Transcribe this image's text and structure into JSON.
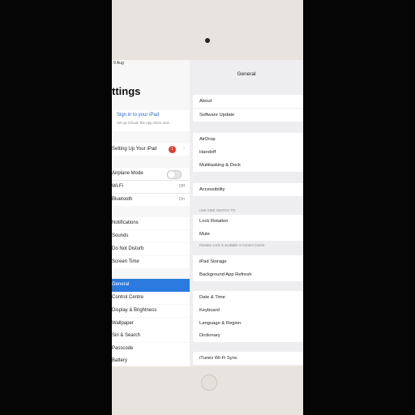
{
  "status": {
    "time": "9 Aug"
  },
  "sidebar": {
    "title": "ttings",
    "signin": {
      "title": "Sign in to your iPad",
      "subtitle": "Set up iCloud, the App Store and..."
    },
    "setup": {
      "label": "Setting Up Your iPad",
      "badge": "1"
    },
    "airplane": {
      "label": "Airplane Mode"
    },
    "wifi": {
      "label": "Wi-Fi",
      "value": "Off"
    },
    "bluetooth": {
      "label": "Bluetooth",
      "value": "On"
    },
    "items": [
      {
        "label": "Notifications"
      },
      {
        "label": "Sounds"
      },
      {
        "label": "Do Not Disturb"
      },
      {
        "label": "Screen Time"
      },
      {
        "label": "General"
      },
      {
        "label": "Control Centre"
      },
      {
        "label": "Display & Brightness"
      },
      {
        "label": "Wallpaper"
      },
      {
        "label": "Siri & Search"
      },
      {
        "label": "Passcode"
      },
      {
        "label": "Battery"
      }
    ]
  },
  "detail": {
    "title": "General",
    "about": "About",
    "software_update": "Software Update",
    "airdrop": "AirDrop",
    "handoff": "Handoff",
    "multitasking": "Multitasking & Dock",
    "accessibility": "Accessibility",
    "side_switch_header": "USE SIDE SWITCH TO:",
    "lock_rotation": "Lock Rotation",
    "mute": "Mute",
    "side_switch_note": "Rotation Lock is available in Control Centre.",
    "ipad_storage": "iPad Storage",
    "background_refresh": "Background App Refresh",
    "date_time": "Date & Time",
    "keyboard": "Keyboard",
    "language_region": "Language & Region",
    "dictionary": "Dictionary",
    "itunes_sync": "iTunes Wi-Fi Sync"
  },
  "colors": {
    "accent": "#2b7ae0",
    "badge": "#e23b2f"
  }
}
